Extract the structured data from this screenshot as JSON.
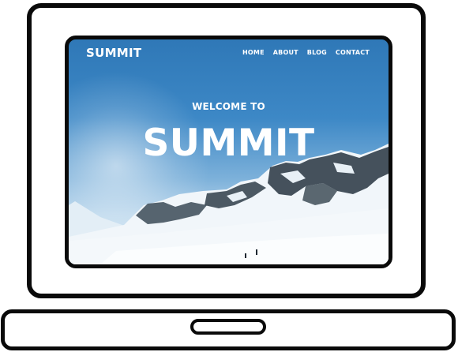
{
  "site": {
    "brand": "SUMMIT",
    "nav": [
      {
        "label": "HOME"
      },
      {
        "label": "ABOUT"
      },
      {
        "label": "BLOG"
      },
      {
        "label": "CONTACT"
      }
    ]
  },
  "hero": {
    "subtitle": "WELCOME TO",
    "title": "SUMMIT"
  },
  "colors": {
    "frame": "#0a0a0a",
    "sky_top": "#2f78b7",
    "snow": "#eef5fa",
    "text": "#ffffff"
  }
}
